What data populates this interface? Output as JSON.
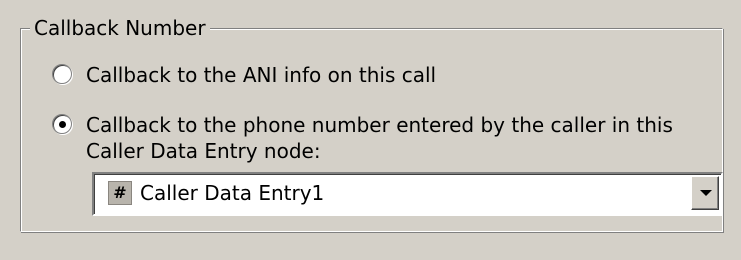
{
  "group": {
    "title": "Callback Number"
  },
  "options": [
    {
      "label": "Callback to the ANI info on this call",
      "selected": false
    },
    {
      "label_line1": "Callback to the phone number entered by the caller in this",
      "label_line2": "Caller Data Entry node:",
      "selected": true
    }
  ],
  "combo": {
    "icon_glyph": "#",
    "icon": "hash-icon",
    "value": "Caller Data Entry1"
  }
}
